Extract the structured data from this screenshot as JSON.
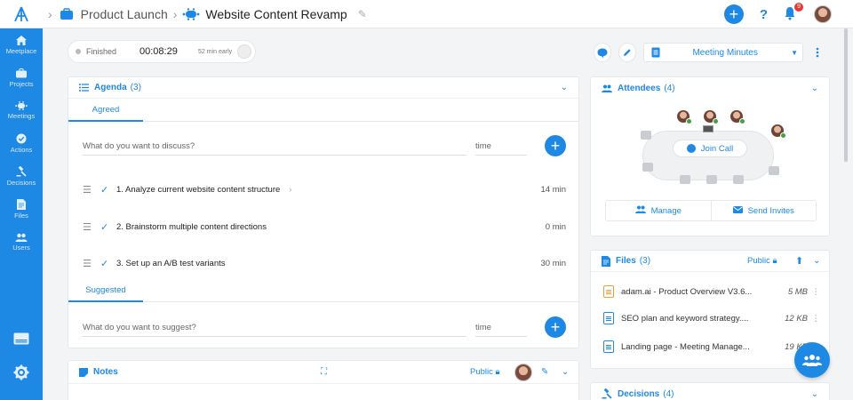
{
  "topbar": {
    "project": "Product Launch",
    "meeting": "Website Content Revamp",
    "notifications": "9"
  },
  "sidebar": {
    "items": [
      {
        "label": "Meetplace",
        "icon": "home-icon"
      },
      {
        "label": "Projects",
        "icon": "briefcase-icon"
      },
      {
        "label": "Meetings",
        "icon": "meeting-icon"
      },
      {
        "label": "Actions",
        "icon": "check-circle-icon"
      },
      {
        "label": "Decisions",
        "icon": "gavel-icon"
      },
      {
        "label": "Files",
        "icon": "file-icon"
      },
      {
        "label": "Users",
        "icon": "users-icon"
      }
    ]
  },
  "timer": {
    "status": "Finished",
    "elapsed": "00:08:29",
    "note": "52 min early"
  },
  "minutes_select": {
    "value": "Meeting Minutes"
  },
  "agenda": {
    "title": "Agenda",
    "count": "(3)",
    "agreed_tab": "Agreed",
    "suggested_tab": "Suggested",
    "discuss_placeholder": "What do you want to discuss?",
    "suggest_placeholder": "What do you want to suggest?",
    "time_placeholder": "time",
    "items": [
      {
        "title": "1. Analyze current website content structure",
        "duration": "14 min"
      },
      {
        "title": "2. Brainstorm multiple content directions",
        "duration": "0 min"
      },
      {
        "title": "3. Set up an A/B test variants",
        "duration": "30 min"
      }
    ]
  },
  "notes": {
    "title": "Notes",
    "visibility": "Public"
  },
  "attendees": {
    "title": "Attendees",
    "count": "(4)",
    "join_label": "Join Call",
    "manage_label": "Manage",
    "invite_label": "Send Invites"
  },
  "files": {
    "title": "Files",
    "count": "(3)",
    "visibility": "Public",
    "items": [
      {
        "name": "adam.ai - Product Overview V3.6...",
        "size": "5 MB"
      },
      {
        "name": "SEO plan and keyword strategy....",
        "size": "12 KB"
      },
      {
        "name": "Landing page - Meeting Manage...",
        "size": "19 KB"
      }
    ]
  },
  "decisions": {
    "title": "Decisions",
    "count": "(4)"
  },
  "colors": {
    "accent": "#1e88e5",
    "badge": "#e53935",
    "online": "#43a047"
  }
}
